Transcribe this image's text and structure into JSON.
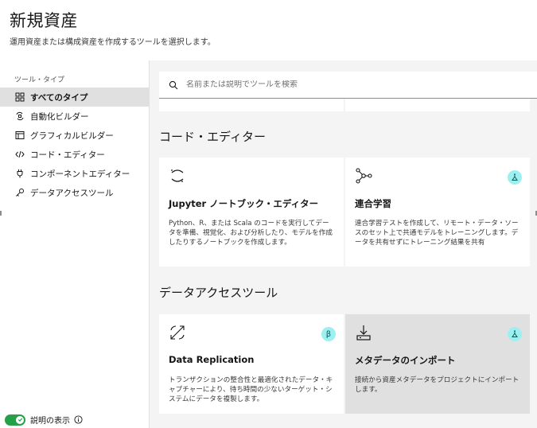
{
  "header": {
    "title": "新規資産",
    "subtitle": "運用資産または構成資産を作成するツールを選択します。"
  },
  "sidebar": {
    "heading": "ツール・タイプ",
    "items": [
      {
        "label": "すべてのタイプ",
        "icon": "grid-icon",
        "active": true
      },
      {
        "label": "自動化ビルダー",
        "icon": "automation-icon",
        "active": false
      },
      {
        "label": "グラフィカルビルダー",
        "icon": "flow-window-icon",
        "active": false
      },
      {
        "label": "コード・エディター",
        "icon": "code-icon",
        "active": false
      },
      {
        "label": "コンポーネントエディター",
        "icon": "plug-icon",
        "active": false
      },
      {
        "label": "データアクセスツール",
        "icon": "key-icon",
        "active": false
      }
    ],
    "toggle_label": "説明の表示",
    "toggle_on": true
  },
  "search": {
    "placeholder": "名前または説明でツールを検索"
  },
  "sections": [
    {
      "title": "コード・エディター",
      "cards": [
        {
          "title": "Jupyter ノートブック・エディター",
          "description": "Python、R、または Scala のコードを実行してデータを準備、視覚化、および分析したり、モデルを作成したりするノートブックを作成します。",
          "icon": "notebook-icon",
          "badge": null
        },
        {
          "title": "連合学習",
          "description": "連合学習テストを作成して、リモート・データ・ソースのセット上で共通モデルをトレーニングします。データを共有せずにトレーニング結果を共有",
          "icon": "federated-learning-icon",
          "badge": "trial-icon"
        }
      ]
    },
    {
      "title": "データアクセスツール",
      "cards": [
        {
          "title": "Data Replication",
          "description": "トランザクションの整合性と最適化されたデータ・キャプチャーにより、待ち時間の少ないターゲット・システムにデータを複製します。",
          "icon": "replication-icon",
          "badge": "β"
        },
        {
          "title": "メタデータのインポート",
          "description": "接続から資産メタデータをプロジェクトにインポートします。",
          "icon": "import-icon",
          "badge": "trial-icon"
        }
      ]
    }
  ],
  "colors": {
    "accent_green": "#24a148",
    "badge_bg": "#9ef0f0",
    "main_bg": "#f4f4f4",
    "active_item_bg": "#e0e0e0"
  }
}
